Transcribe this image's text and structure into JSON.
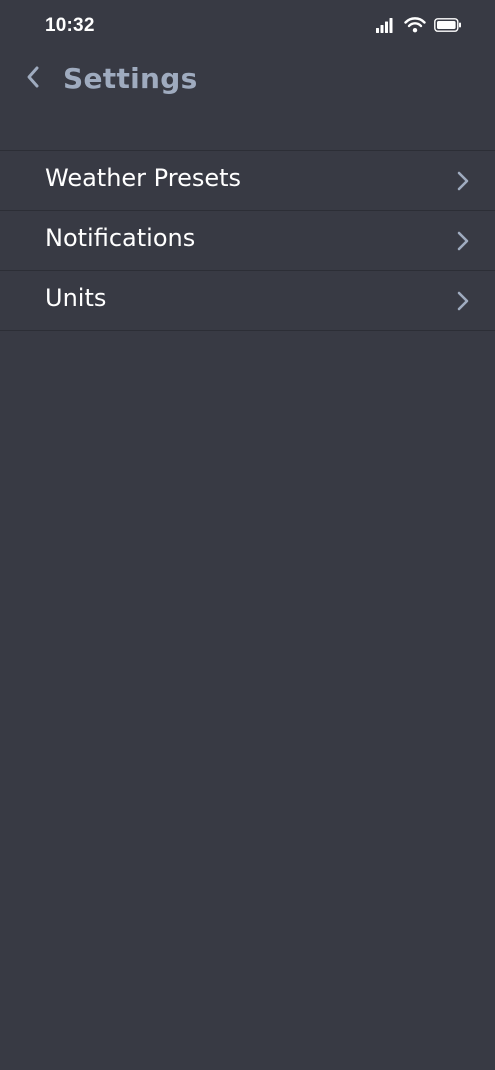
{
  "status_bar": {
    "time": "10:32"
  },
  "nav": {
    "title": "Settings",
    "back_icon": "chevron-left-icon"
  },
  "settings": {
    "items": [
      {
        "label": "Weather Presets",
        "icon": "chevron-right-icon"
      },
      {
        "label": "Notifications",
        "icon": "chevron-right-icon"
      },
      {
        "label": "Units",
        "icon": "chevron-right-icon"
      }
    ]
  },
  "colors": {
    "background": "#383a44",
    "title": "#9fabbf",
    "text": "#ffffff",
    "divider": "#2c2e36",
    "chevron": "#9fabbf"
  }
}
